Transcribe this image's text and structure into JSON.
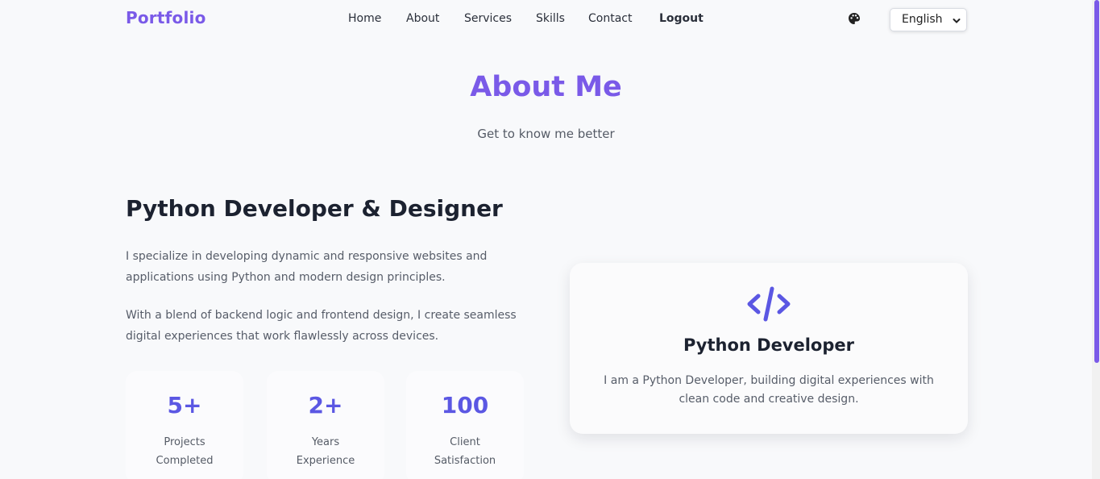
{
  "nav": {
    "logo": "Portfolio",
    "links": [
      "Home",
      "About",
      "Services",
      "Skills",
      "Contact",
      "Logout"
    ],
    "theme_icon": "palette-icon",
    "language": "English"
  },
  "about": {
    "title": "About Me",
    "subtitle": "Get to know me better",
    "headline": "Python Developer & Designer",
    "paragraphs": [
      "I specialize in developing dynamic and responsive websites and applications using Python and modern design principles.",
      "With a blend of backend logic and frontend design, I create seamless digital experiences that work flawlessly across devices."
    ],
    "stats": [
      {
        "value": "5+",
        "label_line1": "Projects",
        "label_line2": "Completed"
      },
      {
        "value": "2+",
        "label_line1": "Years",
        "label_line2": "Experience"
      },
      {
        "value": "100",
        "label_line1": "Client",
        "label_line2": "Satisfaction"
      }
    ],
    "card": {
      "icon": "code-icon",
      "title": "Python Developer",
      "text": "I am a Python Developer, building digital experiences with clean code and creative design."
    }
  },
  "colors": {
    "accent": "#7a5ae8",
    "stat_number": "#5b57e3",
    "background": "#f8f9fb"
  }
}
